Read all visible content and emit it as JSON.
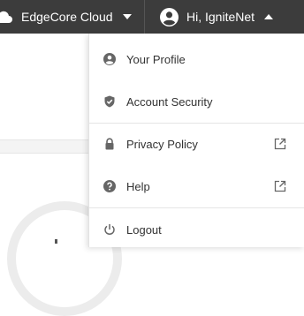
{
  "topbar": {
    "cloud_label": "EdgeCore Cloud",
    "user_greeting": "Hi, IgniteNet"
  },
  "menu": {
    "items": [
      {
        "label": "Your Profile",
        "icon": "user-circle-icon"
      },
      {
        "label": "Account Security",
        "icon": "shield-check-icon"
      },
      {
        "label": "Privacy Policy",
        "icon": "lock-icon",
        "external": true
      },
      {
        "label": "Help",
        "icon": "question-circle-icon",
        "external": true
      },
      {
        "label": "Logout",
        "icon": "power-icon"
      }
    ]
  },
  "colors": {
    "topbar_bg": "#3c3c3c",
    "menu_text": "#333333",
    "icon_gray": "#666666"
  }
}
